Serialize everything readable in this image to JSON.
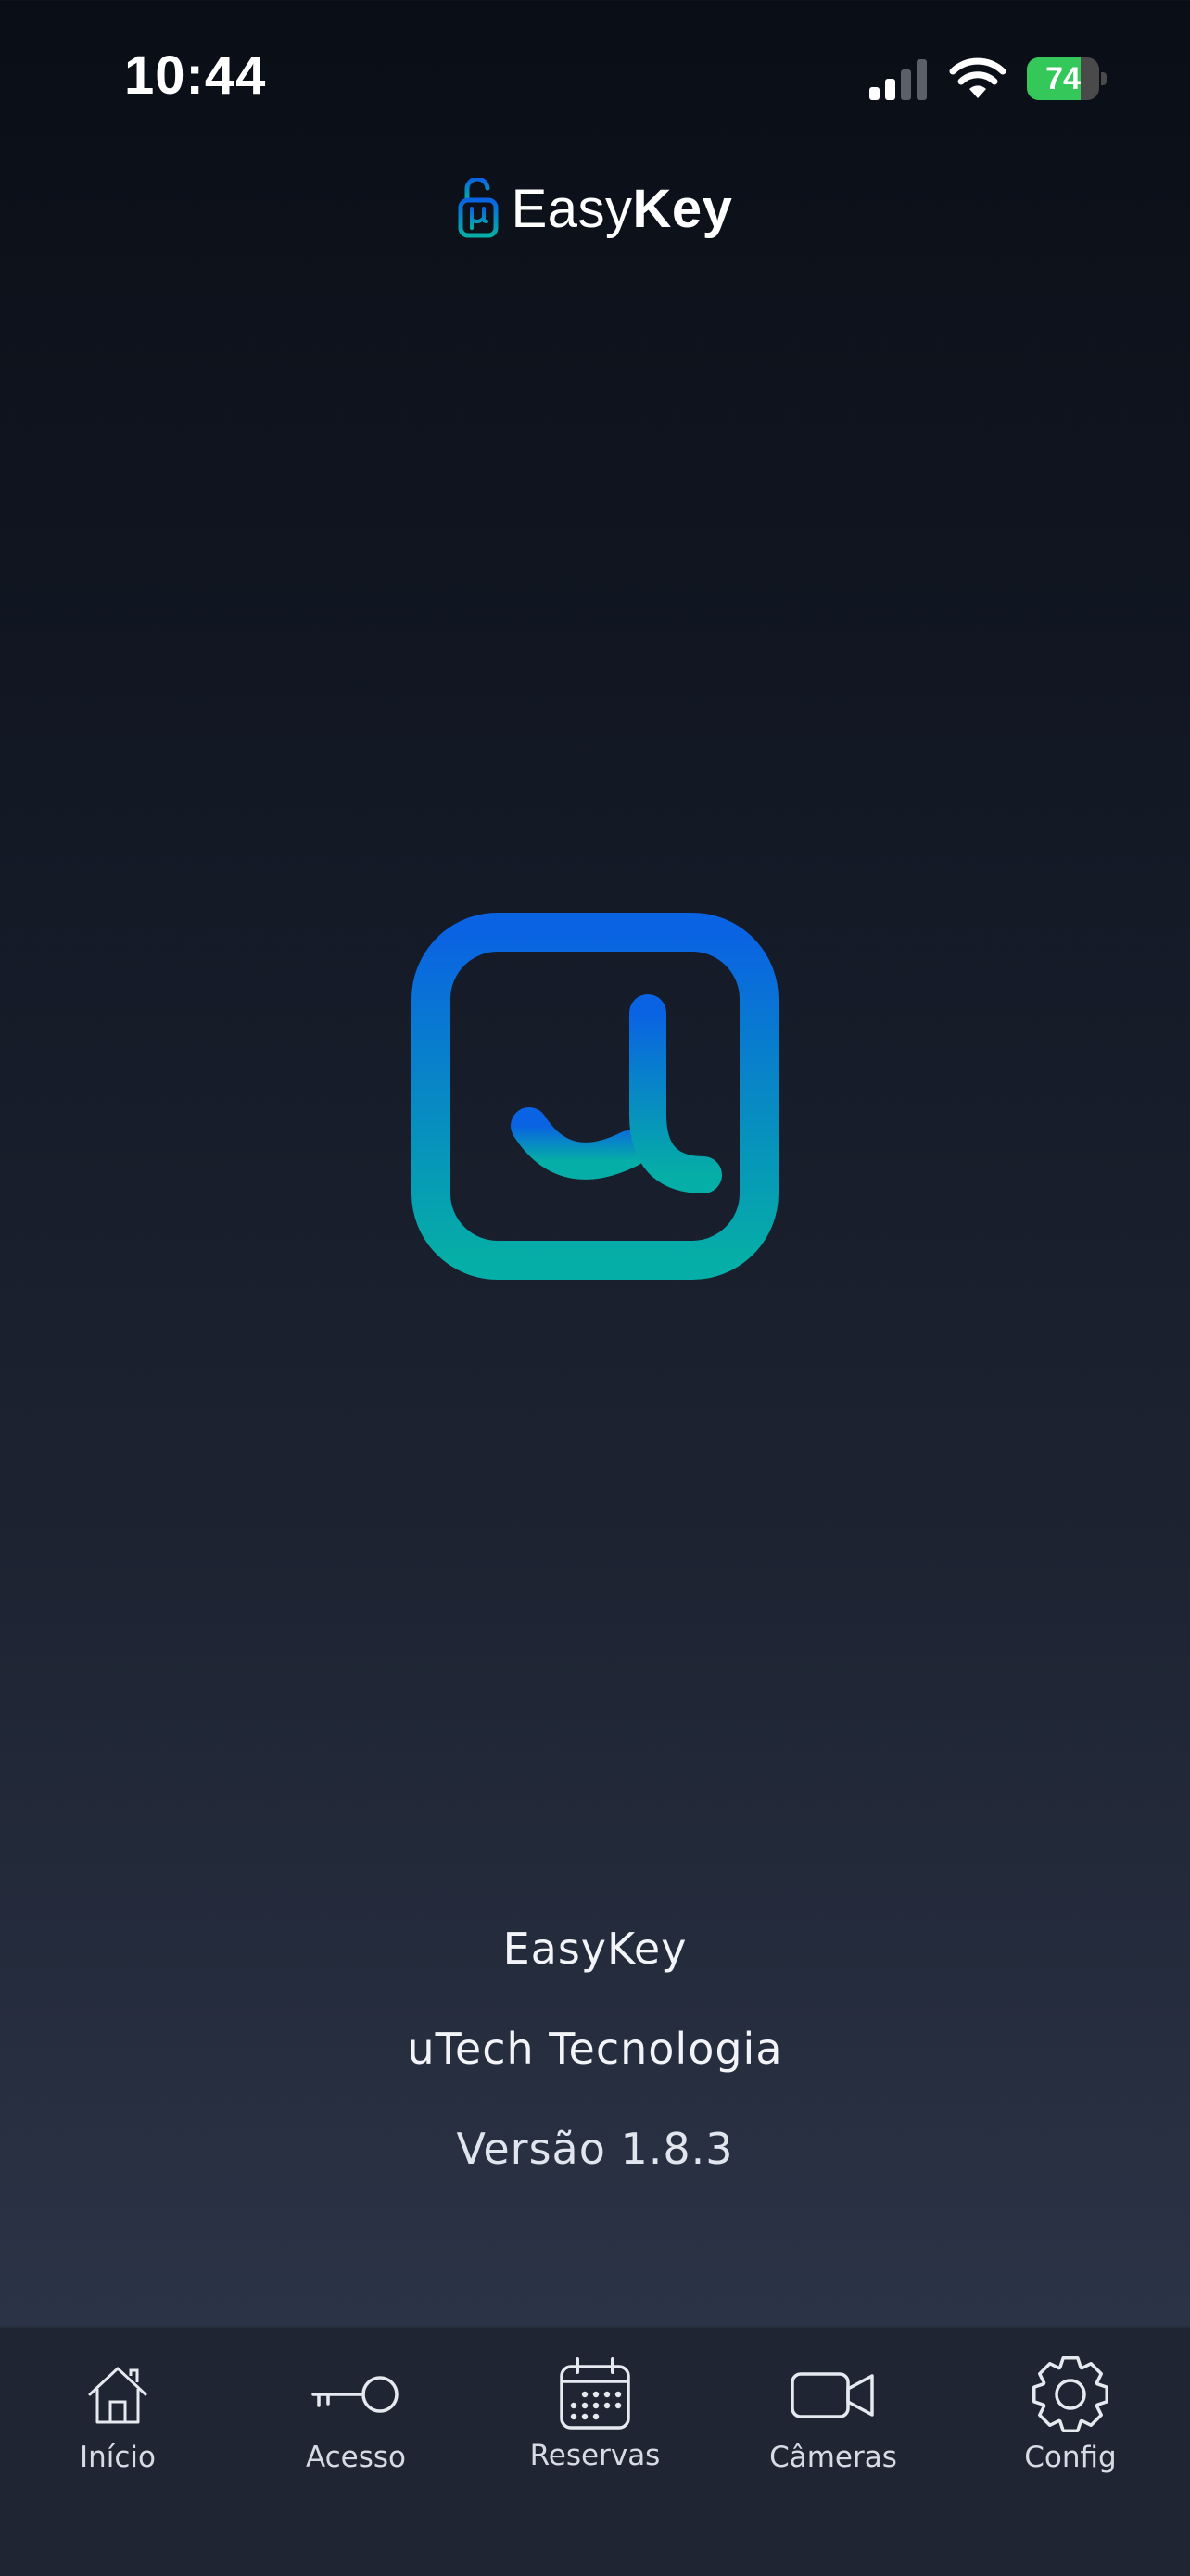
{
  "status_bar": {
    "time": "10:44",
    "battery_percent": "74",
    "battery_level": 0.74,
    "battery_color": "#34c759"
  },
  "header": {
    "brand_light": "Easy",
    "brand_bold": "Key",
    "icon": "padlock-mu-icon"
  },
  "logo": {
    "icon": "utech-mu-logo",
    "gradient_top": "#0a63e3",
    "gradient_bottom": "#05aea6"
  },
  "about": {
    "app_name": "EasyKey",
    "company": "uTech Tecnologia",
    "version": "Versão 1.8.3"
  },
  "tabs": [
    {
      "label": "Início",
      "icon": "home-icon"
    },
    {
      "label": "Acesso",
      "icon": "key-icon"
    },
    {
      "label": "Reservas",
      "icon": "calendar-icon"
    },
    {
      "label": "Câmeras",
      "icon": "video-camera-icon"
    },
    {
      "label": "Config",
      "icon": "gear-icon"
    }
  ]
}
